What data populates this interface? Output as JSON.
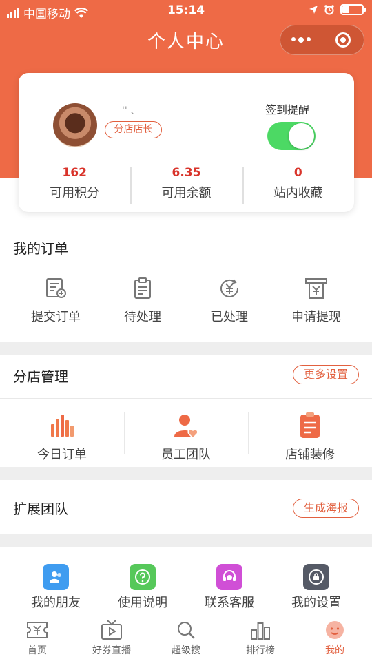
{
  "status_bar": {
    "carrier": "中国移动",
    "time": "15:14"
  },
  "header": {
    "title": "个人中心"
  },
  "profile": {
    "username": "'' 、",
    "role_tag": "分店店长",
    "signin_label": "签到提醒",
    "signin_enabled": true,
    "stats": [
      {
        "value": "162",
        "label": "可用积分"
      },
      {
        "value": "6.35",
        "label": "可用余额"
      },
      {
        "value": "0",
        "label": "站内收藏"
      }
    ]
  },
  "orders": {
    "title": "我的订单",
    "items": [
      {
        "label": "提交订单",
        "icon": "submit-order-icon"
      },
      {
        "label": "待处理",
        "icon": "pending-clipboard-icon"
      },
      {
        "label": "已处理",
        "icon": "processed-yen-icon"
      },
      {
        "label": "申请提现",
        "icon": "withdraw-icon"
      }
    ]
  },
  "branch": {
    "title": "分店管理",
    "more_label": "更多设置",
    "items": [
      {
        "label": "今日订单",
        "icon": "bar-chart-icon"
      },
      {
        "label": "员工团队",
        "icon": "team-user-icon"
      },
      {
        "label": "店铺装修",
        "icon": "shop-decor-icon"
      }
    ]
  },
  "team": {
    "title": "扩展团队",
    "poster_label": "生成海报"
  },
  "tools": {
    "items": [
      {
        "label": "我的朋友",
        "icon": "friends-icon",
        "color": "#3f9cf0"
      },
      {
        "label": "使用说明",
        "icon": "help-icon",
        "color": "#56c85a"
      },
      {
        "label": "联系客服",
        "icon": "customer-service-icon",
        "color": "#d04fd6"
      },
      {
        "label": "我的设置",
        "icon": "settings-icon",
        "color": "#555a66"
      }
    ]
  },
  "tabbar": {
    "items": [
      {
        "label": "首页",
        "icon": "home-ticket-icon"
      },
      {
        "label": "好券直播",
        "icon": "tv-icon"
      },
      {
        "label": "超级搜",
        "icon": "search-icon"
      },
      {
        "label": "排行榜",
        "icon": "ranking-icon"
      },
      {
        "label": "我的",
        "icon": "profile-icon",
        "active": true
      }
    ]
  },
  "colors": {
    "brand": "#ee6a46",
    "accent": "#e2603f",
    "value_red": "#d9342b",
    "toggle_on": "#4cd964"
  }
}
